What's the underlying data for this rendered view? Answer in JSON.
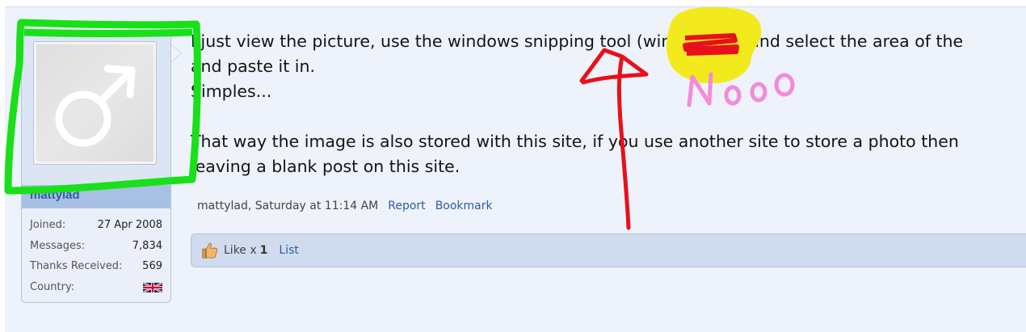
{
  "user": {
    "username": "mattylad",
    "stats": [
      {
        "label": "Joined:",
        "value": "27 Apr 2008"
      },
      {
        "label": "Messages:",
        "value": "7,834"
      },
      {
        "label": "Thanks Received:",
        "value": "569"
      },
      {
        "label": "Country:",
        "value": ""
      }
    ]
  },
  "post": {
    "lines": [
      "I just view the picture, use the windows snipping tool (win7/win10) and select the area of the",
      "and paste it in.",
      "Simples...",
      "",
      "That way the image is also stored with this site, if you use another site to store a photo then",
      "leaving a blank post on this site."
    ],
    "author": "mattylad",
    "timestamp": ", Saturday at 11:14 AM",
    "report_label": "Report",
    "bookmark_label": "Bookmark"
  },
  "likes": {
    "like_label": "Like x",
    "count": "1",
    "list_label": "List"
  },
  "annotation": {
    "handwritten_text": "Nooo",
    "colors": {
      "green": "#19e019",
      "red": "#e8101a",
      "yellow": "#f2ea1c",
      "pink": "#f58ad8"
    }
  }
}
